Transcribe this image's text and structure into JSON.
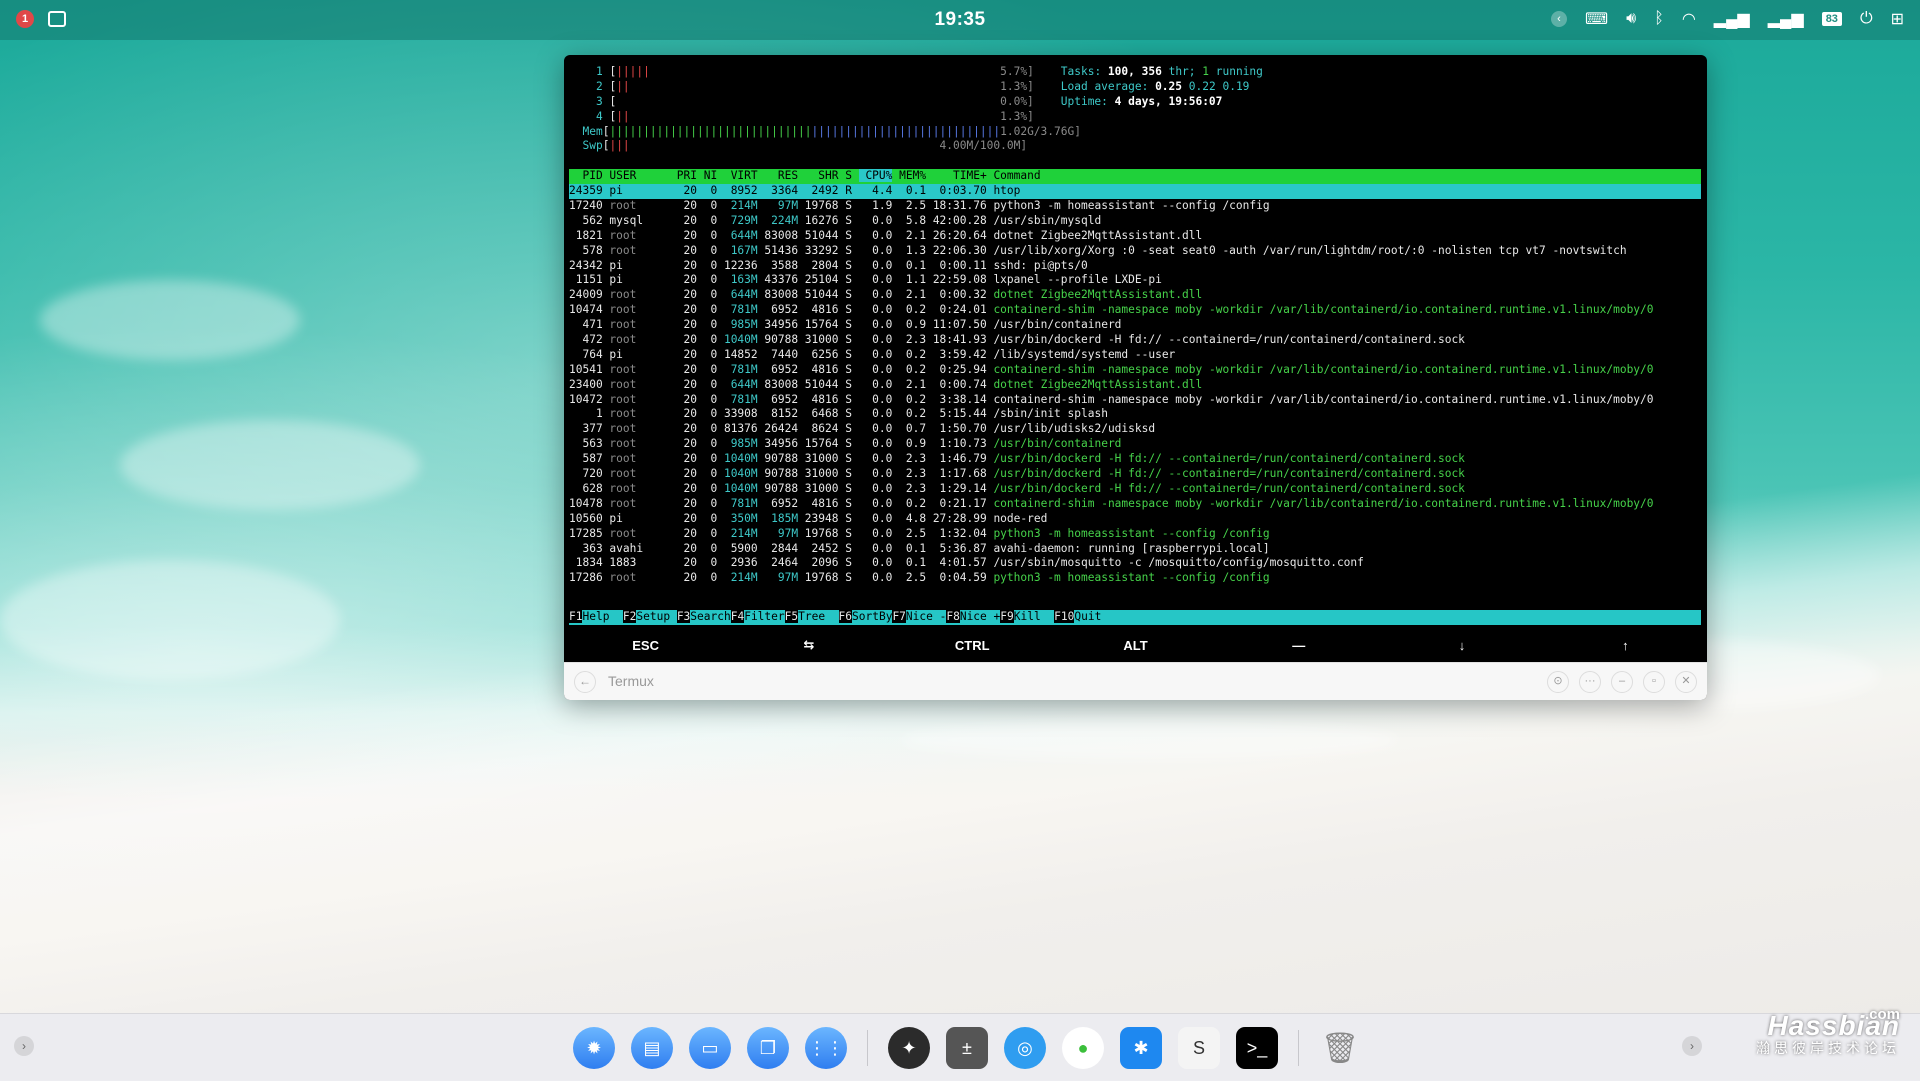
{
  "topbar": {
    "clock": "19:35",
    "notification_count": "1",
    "battery": "83"
  },
  "window": {
    "title": "Termux"
  },
  "htop": {
    "cpus": [
      {
        "num": "1",
        "pct": "5.7%]"
      },
      {
        "num": "2",
        "pct": "1.3%]"
      },
      {
        "num": "3",
        "pct": "0.0%]"
      },
      {
        "num": "4",
        "pct": "1.3%]"
      }
    ],
    "mem_label": "Mem",
    "mem_value": "1.02G/3.76G]",
    "swp_label": "Swp",
    "swp_value": "4.00M/100.0M]",
    "tasks_label": "Tasks:",
    "tasks": "100,",
    "threads": "356",
    "thr_label": "thr;",
    "running": "1",
    "running_label": "running",
    "load_label": "Load average:",
    "load1": "0.25",
    "load5": "0.22",
    "load15": "0.19",
    "uptime_label": "Uptime:",
    "uptime": "4 days, 19:56:07",
    "columns": [
      "PID",
      "USER",
      "PRI",
      "NI",
      "VIRT",
      "RES",
      "SHR",
      "S",
      "CPU%",
      "MEM%",
      "TIME+",
      "Command"
    ],
    "processes": [
      [
        "24359",
        "pi",
        "20",
        "0",
        "8952",
        "3364",
        "2492",
        "R",
        "4.4",
        "0.1",
        "0:03.70",
        "htop"
      ],
      [
        "17240",
        "root",
        "20",
        "0",
        "214M",
        "97M",
        "19768",
        "S",
        "1.9",
        "2.5",
        "18:31.76",
        "python3 -m homeassistant --config /config"
      ],
      [
        "562",
        "mysql",
        "20",
        "0",
        "729M",
        "224M",
        "16276",
        "S",
        "0.0",
        "5.8",
        "42:00.28",
        "/usr/sbin/mysqld"
      ],
      [
        "1821",
        "root",
        "20",
        "0",
        "644M",
        "83008",
        "51044",
        "S",
        "0.0",
        "2.1",
        "26:20.64",
        "dotnet Zigbee2MqttAssistant.dll"
      ],
      [
        "578",
        "root",
        "20",
        "0",
        "167M",
        "51436",
        "33292",
        "S",
        "0.0",
        "1.3",
        "22:06.30",
        "/usr/lib/xorg/Xorg :0 -seat seat0 -auth /var/run/lightdm/root/:0 -nolisten tcp vt7 -novtswitch"
      ],
      [
        "24342",
        "pi",
        "20",
        "0",
        "12236",
        "3588",
        "2804",
        "S",
        "0.0",
        "0.1",
        "0:00.11",
        "sshd: pi@pts/0"
      ],
      [
        "1151",
        "pi",
        "20",
        "0",
        "163M",
        "43376",
        "25104",
        "S",
        "0.0",
        "1.1",
        "22:59.08",
        "lxpanel --profile LXDE-pi"
      ],
      [
        "24009",
        "root",
        "20",
        "0",
        "644M",
        "83008",
        "51044",
        "S",
        "0.0",
        "2.1",
        "0:00.32",
        "dotnet Zigbee2MqttAssistant.dll"
      ],
      [
        "10474",
        "root",
        "20",
        "0",
        "781M",
        "6952",
        "4816",
        "S",
        "0.0",
        "0.2",
        "0:24.01",
        "containerd-shim -namespace moby -workdir /var/lib/containerd/io.containerd.runtime.v1.linux/moby/0"
      ],
      [
        "471",
        "root",
        "20",
        "0",
        "985M",
        "34956",
        "15764",
        "S",
        "0.0",
        "0.9",
        "11:07.50",
        "/usr/bin/containerd"
      ],
      [
        "472",
        "root",
        "20",
        "0",
        "1040M",
        "90788",
        "31000",
        "S",
        "0.0",
        "2.3",
        "18:41.93",
        "/usr/bin/dockerd -H fd:// --containerd=/run/containerd/containerd.sock"
      ],
      [
        "764",
        "pi",
        "20",
        "0",
        "14852",
        "7440",
        "6256",
        "S",
        "0.0",
        "0.2",
        "3:59.42",
        "/lib/systemd/systemd --user"
      ],
      [
        "10541",
        "root",
        "20",
        "0",
        "781M",
        "6952",
        "4816",
        "S",
        "0.0",
        "0.2",
        "0:25.94",
        "containerd-shim -namespace moby -workdir /var/lib/containerd/io.containerd.runtime.v1.linux/moby/0"
      ],
      [
        "23400",
        "root",
        "20",
        "0",
        "644M",
        "83008",
        "51044",
        "S",
        "0.0",
        "2.1",
        "0:00.74",
        "dotnet Zigbee2MqttAssistant.dll"
      ],
      [
        "10472",
        "root",
        "20",
        "0",
        "781M",
        "6952",
        "4816",
        "S",
        "0.0",
        "0.2",
        "3:38.14",
        "containerd-shim -namespace moby -workdir /var/lib/containerd/io.containerd.runtime.v1.linux/moby/0"
      ],
      [
        "1",
        "root",
        "20",
        "0",
        "33908",
        "8152",
        "6468",
        "S",
        "0.0",
        "0.2",
        "5:15.44",
        "/sbin/init splash"
      ],
      [
        "377",
        "root",
        "20",
        "0",
        "81376",
        "26424",
        "8624",
        "S",
        "0.0",
        "0.7",
        "1:50.70",
        "/usr/lib/udisks2/udisksd"
      ],
      [
        "563",
        "root",
        "20",
        "0",
        "985M",
        "34956",
        "15764",
        "S",
        "0.0",
        "0.9",
        "1:10.73",
        "/usr/bin/containerd"
      ],
      [
        "587",
        "root",
        "20",
        "0",
        "1040M",
        "90788",
        "31000",
        "S",
        "0.0",
        "2.3",
        "1:46.79",
        "/usr/bin/dockerd -H fd:// --containerd=/run/containerd/containerd.sock"
      ],
      [
        "720",
        "root",
        "20",
        "0",
        "1040M",
        "90788",
        "31000",
        "S",
        "0.0",
        "2.3",
        "1:17.68",
        "/usr/bin/dockerd -H fd:// --containerd=/run/containerd/containerd.sock"
      ],
      [
        "628",
        "root",
        "20",
        "0",
        "1040M",
        "90788",
        "31000",
        "S",
        "0.0",
        "2.3",
        "1:29.14",
        "/usr/bin/dockerd -H fd:// --containerd=/run/containerd/containerd.sock"
      ],
      [
        "10478",
        "root",
        "20",
        "0",
        "781M",
        "6952",
        "4816",
        "S",
        "0.0",
        "0.2",
        "0:21.17",
        "containerd-shim -namespace moby -workdir /var/lib/containerd/io.containerd.runtime.v1.linux/moby/0"
      ],
      [
        "10560",
        "pi",
        "20",
        "0",
        "350M",
        "185M",
        "23948",
        "S",
        "0.0",
        "4.8",
        "27:28.99",
        "node-red"
      ],
      [
        "17285",
        "root",
        "20",
        "0",
        "214M",
        "97M",
        "19768",
        "S",
        "0.0",
        "2.5",
        "1:32.04",
        "python3 -m homeassistant --config /config"
      ],
      [
        "363",
        "avahi",
        "20",
        "0",
        "5900",
        "2844",
        "2452",
        "S",
        "0.0",
        "0.1",
        "5:36.87",
        "avahi-daemon: running [raspberrypi.local]"
      ],
      [
        "1834",
        "1883",
        "20",
        "0",
        "2936",
        "2464",
        "2096",
        "S",
        "0.0",
        "0.1",
        "4:01.57",
        "/usr/sbin/mosquitto -c /mosquitto/config/mosquitto.conf"
      ],
      [
        "17286",
        "root",
        "20",
        "0",
        "214M",
        "97M",
        "19768",
        "S",
        "0.0",
        "2.5",
        "0:04.59",
        "python3 -m homeassistant --config /config"
      ]
    ],
    "thread_rows": [
      7,
      8,
      12,
      13,
      17,
      18,
      19,
      20,
      21,
      23,
      26
    ],
    "fkeys": [
      {
        "n": "F1",
        "l": "Help  "
      },
      {
        "n": "F2",
        "l": "Setup "
      },
      {
        "n": "F3",
        "l": "Search"
      },
      {
        "n": "F4",
        "l": "Filter"
      },
      {
        "n": "F5",
        "l": "Tree  "
      },
      {
        "n": "F6",
        "l": "SortBy"
      },
      {
        "n": "F7",
        "l": "Nice -"
      },
      {
        "n": "F8",
        "l": "Nice +"
      },
      {
        "n": "F9",
        "l": "Kill  "
      },
      {
        "n": "F10",
        "l": "Quit      "
      }
    ]
  },
  "extra_keys": [
    "ESC",
    "⇆",
    "CTRL",
    "ALT",
    "—",
    "↓",
    "↑"
  ],
  "watermark": {
    "brand": "Hassbian",
    "tld": ".com",
    "tagline": "瀚思彼岸技术论坛"
  },
  "colors": {
    "header_green": "#1fd13a",
    "selection_cyan": "#2ac8c8",
    "thread_green": "#46d24a"
  }
}
